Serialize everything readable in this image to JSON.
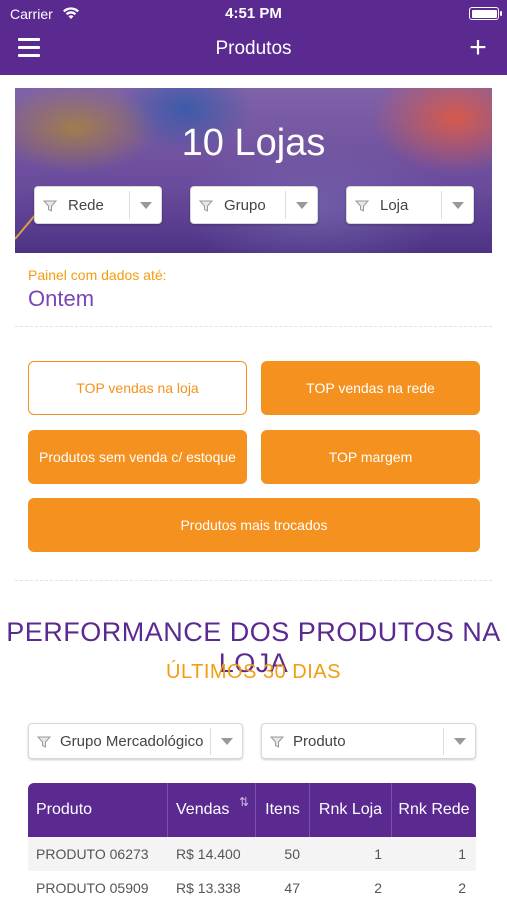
{
  "status_bar": {
    "carrier": "Carrier",
    "time": "4:51 PM"
  },
  "nav": {
    "title": "Produtos"
  },
  "hero": {
    "title": "10 Lojas"
  },
  "filters": [
    {
      "label": "Rede"
    },
    {
      "label": "Grupo"
    },
    {
      "label": "Loja"
    }
  ],
  "panel": {
    "label": "Painel com dados até:",
    "value": "Ontem"
  },
  "top_buttons": [
    {
      "label": "TOP vendas na loja",
      "selected": true
    },
    {
      "label": "TOP vendas na rede",
      "selected": false
    },
    {
      "label": "Produtos sem venda c/ estoque",
      "selected": false
    },
    {
      "label": "TOP margem",
      "selected": false
    },
    {
      "label": "Produtos mais trocados",
      "selected": false
    }
  ],
  "performance": {
    "title": "PERFORMANCE DOS PRODUTOS NA LOJA",
    "subtitle": "ÚLTIMOS 30 DIAS"
  },
  "selectors": [
    {
      "label": "Grupo Mercadológico"
    },
    {
      "label": "Produto"
    }
  ],
  "table": {
    "columns": [
      "Produto",
      "Vendas",
      "Itens",
      "Rnk Loja",
      "Rnk Rede"
    ],
    "rows": [
      [
        "PRODUTO 06273",
        "R$ 14.400",
        "50",
        "1",
        "1"
      ],
      [
        "PRODUTO 05909",
        "R$ 13.338",
        "47",
        "2",
        "2"
      ]
    ]
  },
  "colors": {
    "primary": "#5b2a91",
    "accent": "#f5911e",
    "panel_value": "#7b45b8"
  }
}
